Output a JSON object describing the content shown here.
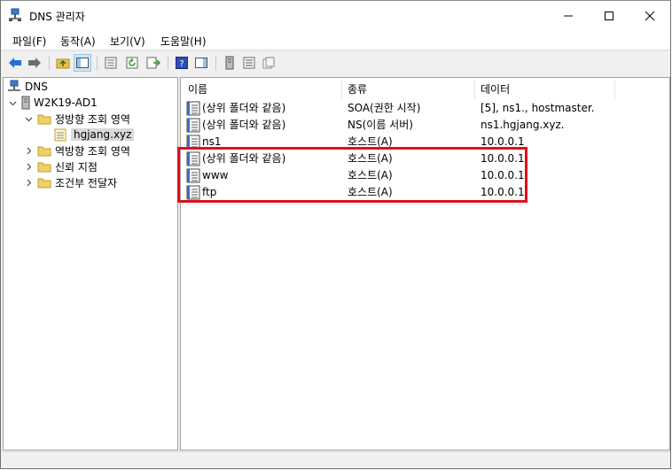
{
  "window": {
    "title": "DNS 관리자",
    "accent_color": "#e30e1c"
  },
  "menu": [
    "파일(F)",
    "동작(A)",
    "보기(V)",
    "도움말(H)"
  ],
  "toolbar": {
    "icons": [
      "back-icon",
      "forward-icon",
      "up-folder-icon",
      "show-hide-tree-icon",
      "properties-icon",
      "refresh-icon",
      "export-icon",
      "help-icon",
      "show-hide-action-pane-icon",
      "server-icon",
      "list-view-icon",
      "detail-view-icon"
    ]
  },
  "tree": {
    "root": "DNS",
    "server": "W2K19-AD1",
    "forward_zones": "정방향 조회 영역",
    "zone": "hgjang.xyz",
    "reverse_zones": "역방향 조회 영역",
    "trust_points": "신뢰 지점",
    "conditional_forwarders": "조건부 전달자"
  },
  "list": {
    "columns": [
      "이름",
      "종류",
      "데이터"
    ],
    "rows": [
      {
        "name": "(상위 폴더와 같음)",
        "type": "SOA(권한 시작)",
        "data": "[5], ns1., hostmaster."
      },
      {
        "name": "(상위 폴더와 같음)",
        "type": "NS(이름 서버)",
        "data": "ns1.hgjang.xyz."
      },
      {
        "name": "ns1",
        "type": "호스트(A)",
        "data": "10.0.0.1"
      },
      {
        "name": "(상위 폴더와 같음)",
        "type": "호스트(A)",
        "data": "10.0.0.1"
      },
      {
        "name": "www",
        "type": "호스트(A)",
        "data": "10.0.0.1"
      },
      {
        "name": "ftp",
        "type": "호스트(A)",
        "data": "10.0.0.1"
      }
    ]
  }
}
